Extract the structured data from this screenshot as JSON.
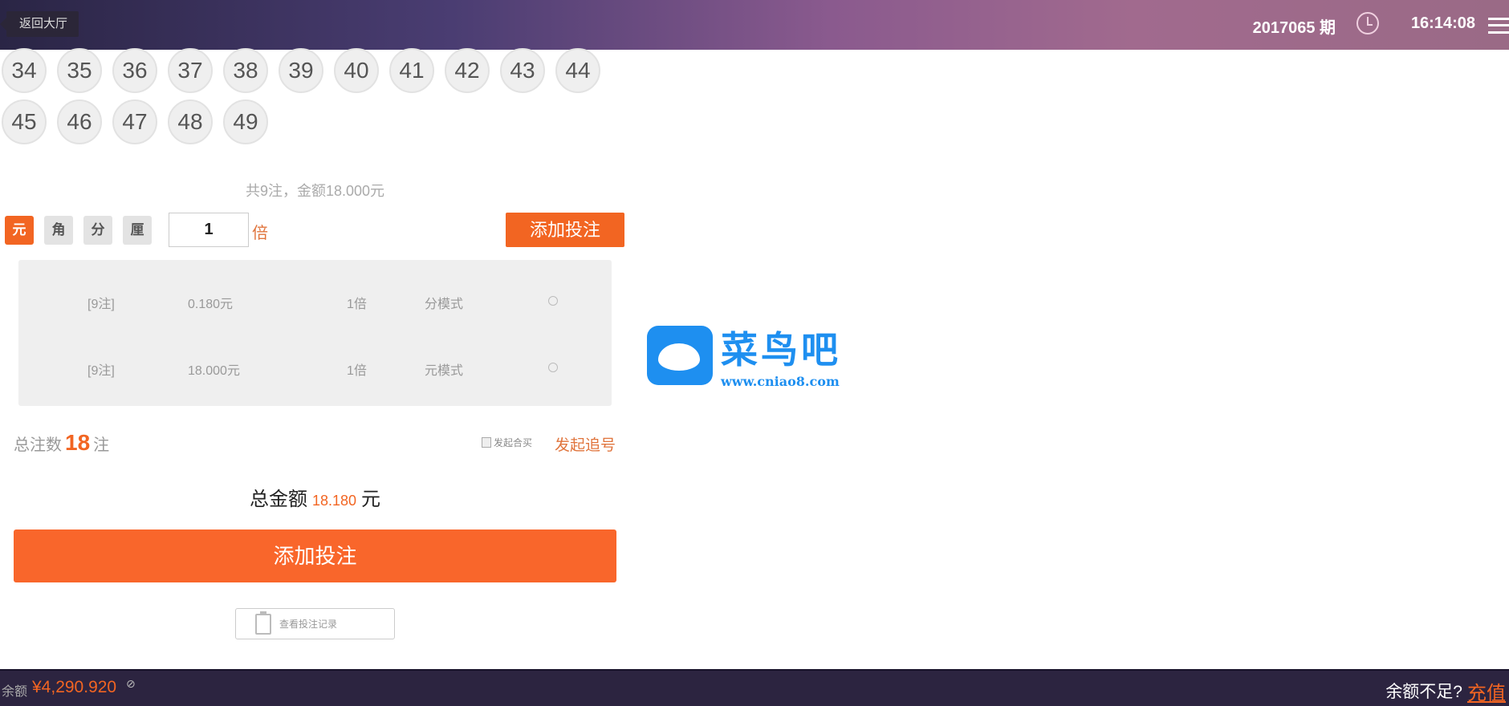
{
  "header": {
    "back_label": "返回大厅",
    "period": "2017065 期",
    "time": "16:14:08"
  },
  "balls": [
    "34",
    "35",
    "36",
    "37",
    "38",
    "39",
    "40",
    "41",
    "42",
    "43",
    "44",
    "45",
    "46",
    "47",
    "48",
    "49"
  ],
  "summary": "共9注，金额18.000元",
  "units": [
    "元",
    "角",
    "分",
    "厘"
  ],
  "multiplier": "1",
  "multiplier_unit": "倍",
  "add_small_label": "添加投注",
  "bets": [
    {
      "count": "[9注]",
      "amount": "0.180元",
      "multiple": "1倍",
      "mode": "分模式"
    },
    {
      "count": "[9注]",
      "amount": "18.000元",
      "multiple": "1倍",
      "mode": "元模式"
    }
  ],
  "total": {
    "label": "总注数",
    "count": "18",
    "suffix": "注",
    "amount_label": "总金额",
    "amount": "18.180",
    "amount_unit": "元"
  },
  "joint_label": "发起合买",
  "chase_label": "发起追号",
  "add_big_label": "添加投注",
  "record_label": "查看投注记录",
  "watermark": {
    "name": "菜鸟吧",
    "url": "www.cniao8.com"
  },
  "footer": {
    "balance_label": "余额",
    "balance": "¥4,290.920",
    "insufficient": "余额不足?",
    "recharge": "充值"
  }
}
